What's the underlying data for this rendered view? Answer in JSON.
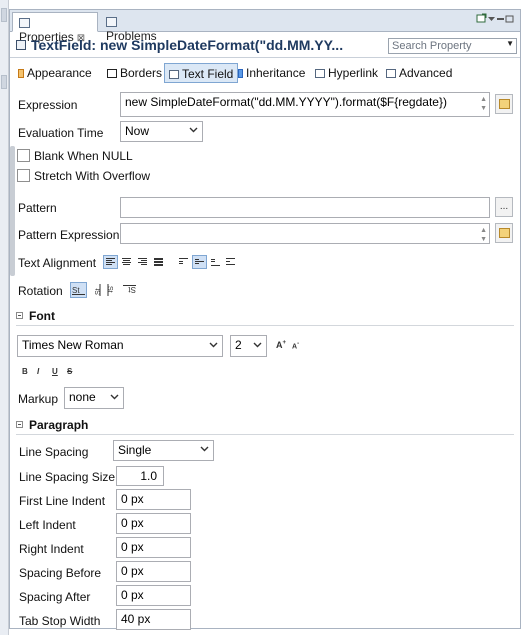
{
  "window": {
    "tabs": [
      {
        "label": "Properties",
        "close": "⊠"
      },
      {
        "label": "Problems"
      }
    ],
    "title": "TextField: new SimpleDateFormat(\"dd.MM.YY...",
    "search_placeholder": "Search Property",
    "subtabs": [
      "Appearance",
      "Borders",
      "Text Field",
      "Inheritance",
      "Hyperlink",
      "Advanced"
    ]
  },
  "expression": {
    "label": "Expression",
    "value": "new SimpleDateFormat(\"dd.MM.YYYY\").format($F{regdate})"
  },
  "evaluation_time": {
    "label": "Evaluation Time",
    "value": "Now"
  },
  "blank_when_null": {
    "label": "Blank When NULL",
    "checked": false
  },
  "stretch_with_overflow": {
    "label": "Stretch With Overflow",
    "checked": false
  },
  "pattern": {
    "label": "Pattern",
    "value": "",
    "button": "..."
  },
  "pattern_expression": {
    "label": "Pattern Expression",
    "value": ""
  },
  "text_alignment": {
    "label": "Text Alignment"
  },
  "rotation": {
    "label": "Rotation"
  },
  "font": {
    "section": "Font",
    "family": "Times New Roman",
    "size": "2",
    "grow": "A",
    "shrink": "A",
    "styles": [
      "B",
      "I",
      "U",
      "S"
    ],
    "markup_label": "Markup",
    "markup_value": "none"
  },
  "paragraph": {
    "section": "Paragraph",
    "line_spacing": {
      "label": "Line Spacing",
      "value": "Single"
    },
    "line_spacing_size": {
      "label": "Line Spacing Size",
      "value": "1.0"
    },
    "first_line_indent": {
      "label": "First Line Indent",
      "value": "0 px"
    },
    "left_indent": {
      "label": "Left Indent",
      "value": "0 px"
    },
    "right_indent": {
      "label": "Right Indent",
      "value": "0 px"
    },
    "spacing_before": {
      "label": "Spacing Before",
      "value": "0 px"
    },
    "spacing_after": {
      "label": "Spacing After",
      "value": "0 px"
    },
    "tab_stop_width": {
      "label": "Tab Stop Width",
      "value": "40 px"
    }
  },
  "colors": {
    "accent": "#1f3a60",
    "selection": "#dbe8f6",
    "tabstrip": "#dde5ef"
  }
}
